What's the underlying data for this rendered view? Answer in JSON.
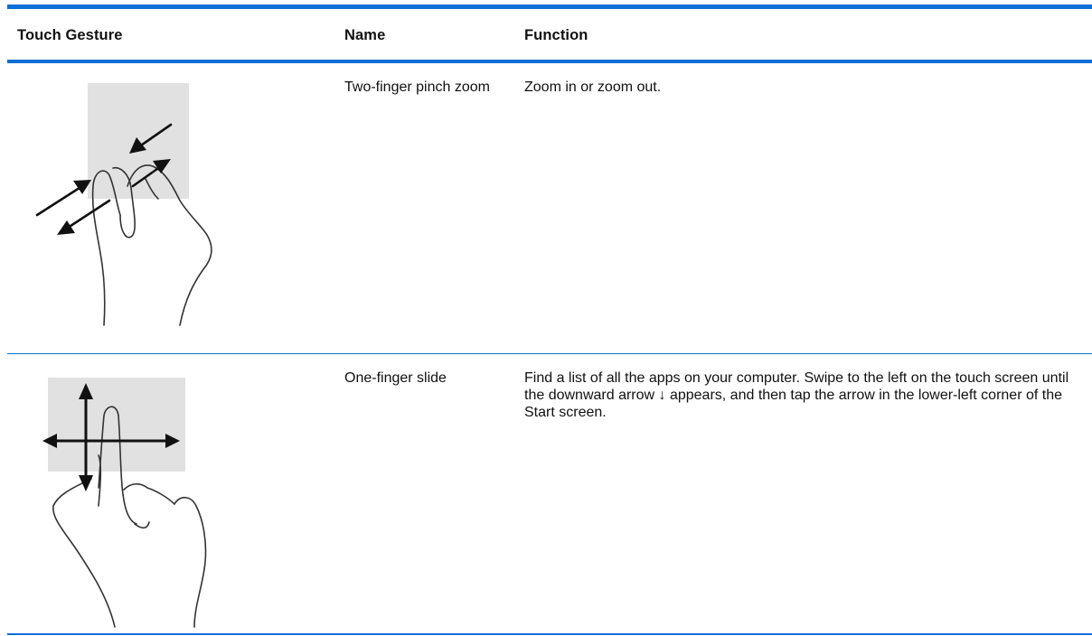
{
  "table": {
    "headers": {
      "gesture": "Touch Gesture",
      "name": "Name",
      "function": "Function"
    },
    "rows": [
      {
        "gesture_icon": "two-finger-pinch-zoom-illustration",
        "name": "Two-finger pinch zoom",
        "function": "Zoom in or zoom out."
      },
      {
        "gesture_icon": "one-finger-slide-illustration",
        "name": "One-finger slide",
        "function": "Find a list of all the apps on your computer. Swipe to the left on the touch screen until the downward arrow ↓ appears, and then tap the arrow in the lower-left corner of the Start screen."
      }
    ]
  },
  "colors": {
    "rule": "#0a6fd6",
    "gesture_panel": "#e1e1e1"
  }
}
